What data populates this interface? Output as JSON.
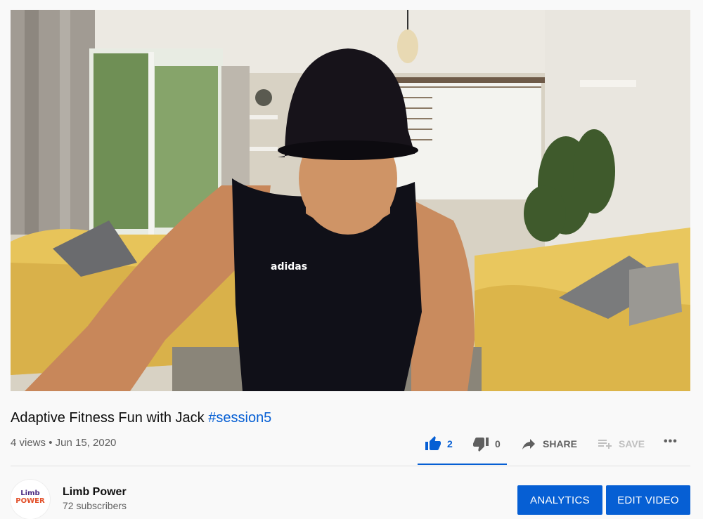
{
  "video": {
    "title_main": "Adaptive Fitness Fun with Jack",
    "title_hashtag": "#session5",
    "views": "4 views",
    "separator": "•",
    "date": "Jun 15, 2020",
    "shirt_logo_text": "adidas"
  },
  "actions": {
    "like_count": "2",
    "dislike_count": "0",
    "share_label": "SHARE",
    "save_label": "SAVE",
    "more_label": "•••"
  },
  "channel": {
    "name": "Limb Power",
    "subscribers": "72 subscribers",
    "logo_text_top": "Limb",
    "logo_text_bottom": "POWER"
  },
  "buttons": {
    "analytics": "ANALYTICS",
    "edit_video": "EDIT VIDEO"
  },
  "colors": {
    "accent": "#065fd4",
    "text_secondary": "#606060",
    "background": "#f9f9f9"
  },
  "icons": {
    "like": "thumbs-up-icon",
    "dislike": "thumbs-down-icon",
    "share": "share-arrow-icon",
    "save": "playlist-add-icon",
    "more": "more-horizontal-icon"
  }
}
